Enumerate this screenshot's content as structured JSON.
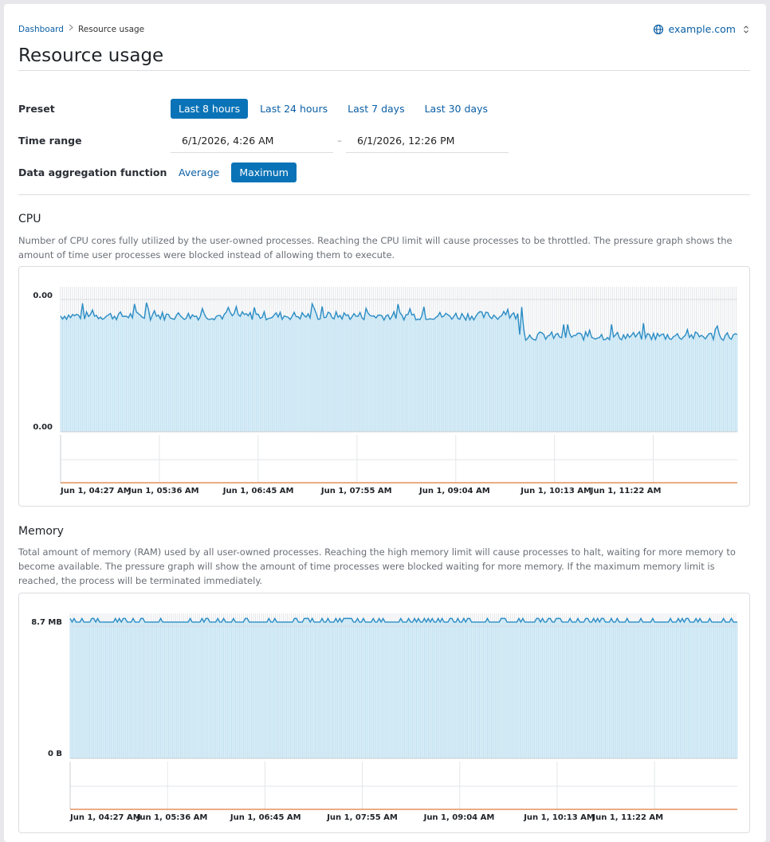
{
  "breadcrumb": {
    "root": "Dashboard",
    "current": "Resource usage"
  },
  "site": {
    "name": "example.com"
  },
  "page_title": "Resource usage",
  "filters": {
    "preset_label": "Preset",
    "presets": [
      "Last 8 hours",
      "Last 24 hours",
      "Last 7 days",
      "Last 30 days"
    ],
    "active_preset": "Last 8 hours",
    "time_range_label": "Time range",
    "start": "6/1/2026, 4:26 AM",
    "range_separator": "–",
    "end": "6/1/2026, 12:26 PM",
    "aggregation_label": "Data aggregation function",
    "functions": [
      "Average",
      "Maximum"
    ],
    "active_function": "Maximum"
  },
  "cpu": {
    "title": "CPU",
    "description": "Number of CPU cores fully utilized by the user-owned processes. Reaching the CPU limit will cause processes to be throttled. The pressure graph shows the amount of time user processes were blocked instead of allowing them to execute."
  },
  "memory": {
    "title": "Memory",
    "description": "Total amount of memory (RAM) used by all user-owned processes. Reaching the high memory limit will cause processes to halt, waiting for more memory to become available. The pressure graph will show the amount of time processes were blocked waiting for more memory. If the maximum memory limit is reached, the process will be terminated immediately."
  },
  "colors": {
    "accent": "#0a73b7",
    "line": "#2b8cc4",
    "fill": "#d6ecf7",
    "pressure": "#e07a3f"
  },
  "chart_data": [
    {
      "type": "area",
      "series": [
        {
          "values": []
        }
      ],
      "ytick_labels": [
        "0.00",
        "0.00"
      ],
      "x_tick_labels": [
        "Jun 1, 04:27 AM",
        "Jun 1, 05:36 AM",
        "Jun 1, 06:45 AM",
        "Jun 1, 07:55 AM",
        "Jun 1, 09:04 AM",
        "Jun 1, 10:13 AM",
        "Jun 1, 11:22 AM"
      ],
      "pressure_values": [
        0,
        0,
        0,
        0,
        0,
        0,
        0
      ]
    },
    {
      "type": "area",
      "series": [
        {
          "values": []
        }
      ],
      "ytick_labels": [
        "8.7 MB",
        "0 B"
      ],
      "x_tick_labels": [
        "Jun 1, 04:27 AM",
        "Jun 1, 05:36 AM",
        "Jun 1, 06:45 AM",
        "Jun 1, 07:55 AM",
        "Jun 1, 09:04 AM",
        "Jun 1, 10:13 AM",
        "Jun 1, 11:22 AM"
      ],
      "pressure_values": [
        0,
        0,
        0,
        0,
        0,
        0,
        0
      ]
    }
  ]
}
